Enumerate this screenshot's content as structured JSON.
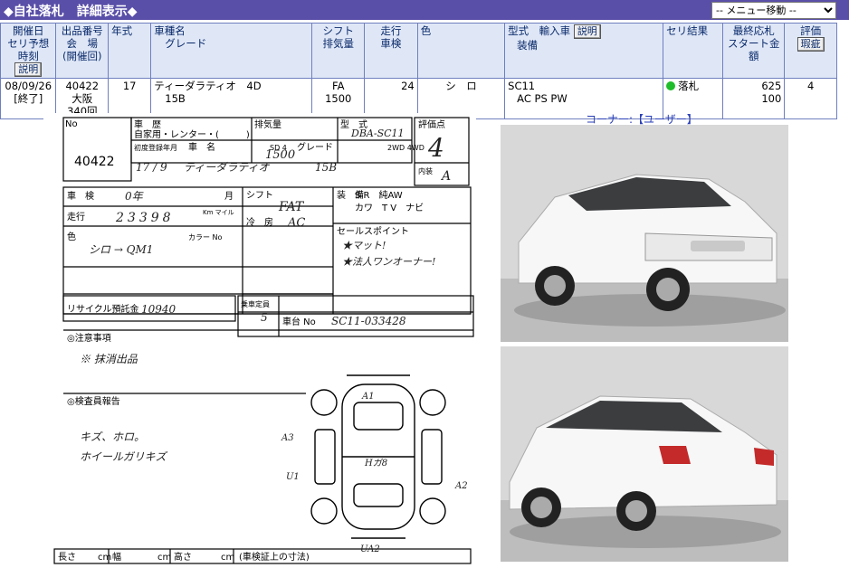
{
  "header": {
    "title": "◆自社落札　詳細表示◆",
    "menu_select": "-- メニュー移動 --"
  },
  "columns": {
    "date_l1": "開催日",
    "date_l2": "セリ予想時刻",
    "explain": "説明",
    "lot_l1": "出品番号",
    "lot_l2": "会　場",
    "lot_l3": "(開催回)",
    "year": "年式",
    "car_l1": "車種名",
    "car_l2": "グレード",
    "shift_l1": "シフト",
    "shift_l2": "排気量",
    "mileage_l1": "走行",
    "mileage_l2": "車検",
    "color": "色",
    "model_l1": "型式　輸入車",
    "model_l2": "装備",
    "model_btn": "説明",
    "result": "セリ結果",
    "price_l1": "最終応札",
    "price_l2": "スタート金額",
    "rating_l1": "評価",
    "rating_btn": "瑕疵"
  },
  "row": {
    "date": "08/09/26",
    "status": "[終了]",
    "lot": "40422",
    "venue": "大阪",
    "round": "340回",
    "year": "17",
    "car": "ティーダラティオ　4D",
    "grade": "15B",
    "shift": "FA",
    "displacement": "1500",
    "mileage": "24",
    "color": "シ　ロ",
    "model": "SC11",
    "equipment": "AC PS PW",
    "result": "落札",
    "final_bid": "625",
    "start_price": "100",
    "rating": "4"
  },
  "sheet": {
    "lot_no": "40422",
    "labels": {
      "no": "No",
      "usage": "車　歴",
      "usage_opts": "自家用・レンター・(　　　)",
      "displacement": "排気量",
      "type": "型　式",
      "rating_pt": "評価点",
      "first_reg": "初度登録年月",
      "car_name": "車　名",
      "doors": "SD 4",
      "grade": "グレード",
      "wd": "2WD\n4WD",
      "shaken": "車　検",
      "month": "月",
      "mileage": "走行",
      "km": "Km\nマイル",
      "shift": "シフト",
      "ac": "冷　房",
      "color": "色",
      "color_code": "カラー No",
      "options": "装　備",
      "opts1": "S R　純AW　",
      "opts2": "カワ　T V　ナビ",
      "sales": "セールスポイント",
      "recycle": "リサイクル預託金",
      "capacity": "乗車定員",
      "chassis": "車台 No",
      "notes": "◎注意事項",
      "inspector": "◎検査員報告",
      "length": "長さ",
      "width": "幅",
      "height": "高さ",
      "cm": "cm",
      "dims": "(車検証上の寸法)",
      "interior": "内装"
    },
    "hw": {
      "type": "DBA-SC11",
      "disp": "1500",
      "rating": "4",
      "interior": "A",
      "reg": "17 / 9",
      "name": "ティーダラティオ",
      "grade": "15B",
      "shaken": "0年",
      "km": "23398",
      "shift": "FAT",
      "ac": "AC",
      "color": "シロ → QM1",
      "notes": "※ 抹消出品",
      "report": "キズ、ホロ。",
      "report2": "ホイールガリキズ",
      "sales1": "★マット!",
      "sales2": "★法人ワンオーナー!",
      "recycle": "10940",
      "seats": "5",
      "chassis": "SC11-033428",
      "marks": {
        "a1": "A1",
        "a3": "A3",
        "u1": "U1",
        "a2": "A2",
        "ua2": "UA2",
        "center": "Hガ8"
      }
    }
  },
  "corner": "コーナー:【ユーザー】",
  "colors": {
    "title_bg": "#5a4fa8",
    "header_bg": "#dfe7f7",
    "border": "#6f7fbf",
    "result_dot": "#1fbd2b",
    "corner_text": "#2a3fb8"
  }
}
